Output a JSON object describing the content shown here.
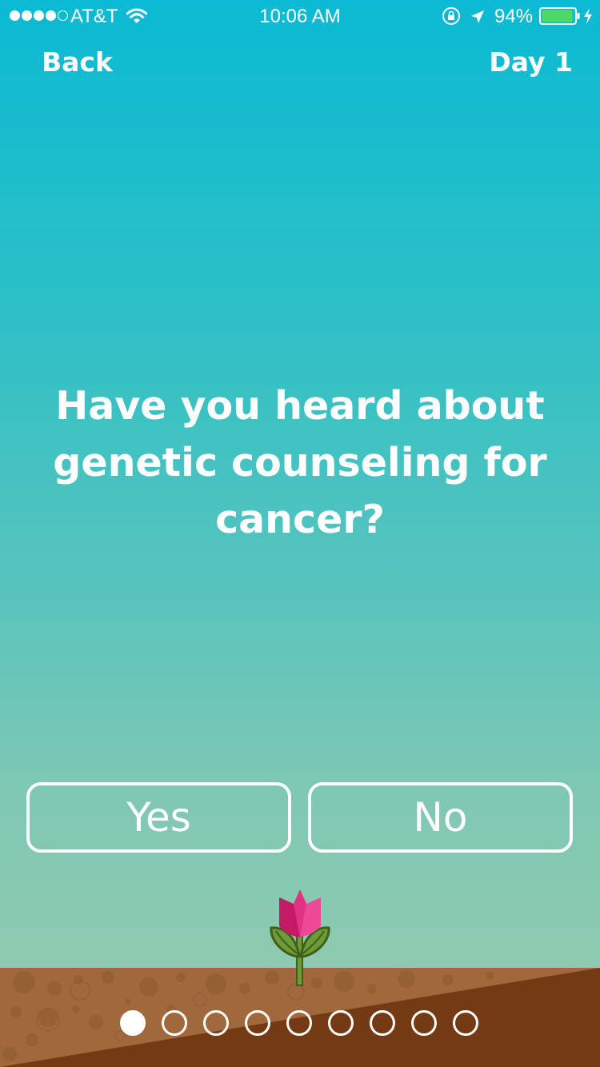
{
  "status_bar": {
    "carrier": "AT&T",
    "time": "10:06 AM",
    "battery": "94%",
    "signal_bars": 4,
    "signal_max": 5,
    "icons": [
      "wifi-icon",
      "lock-rotation-icon",
      "location-arrow-icon",
      "battery-icon",
      "charging-icon"
    ]
  },
  "nav": {
    "back_label": "Back",
    "day_label": "Day 1"
  },
  "question": {
    "line1": "Have you heard about",
    "line2": "genetic counseling for",
    "line3": "cancer?"
  },
  "answers": {
    "yes_label": "Yes",
    "no_label": "No"
  },
  "pager": {
    "total": 9,
    "current": 1
  },
  "colors": {
    "sky_top": "#0bbad3",
    "sky_bottom": "#96cbad",
    "soil_light": "#a0683c",
    "soil_dark": "#743a14",
    "petal_pink": "#ec4a97",
    "leaf_green": "#6e9a38"
  }
}
